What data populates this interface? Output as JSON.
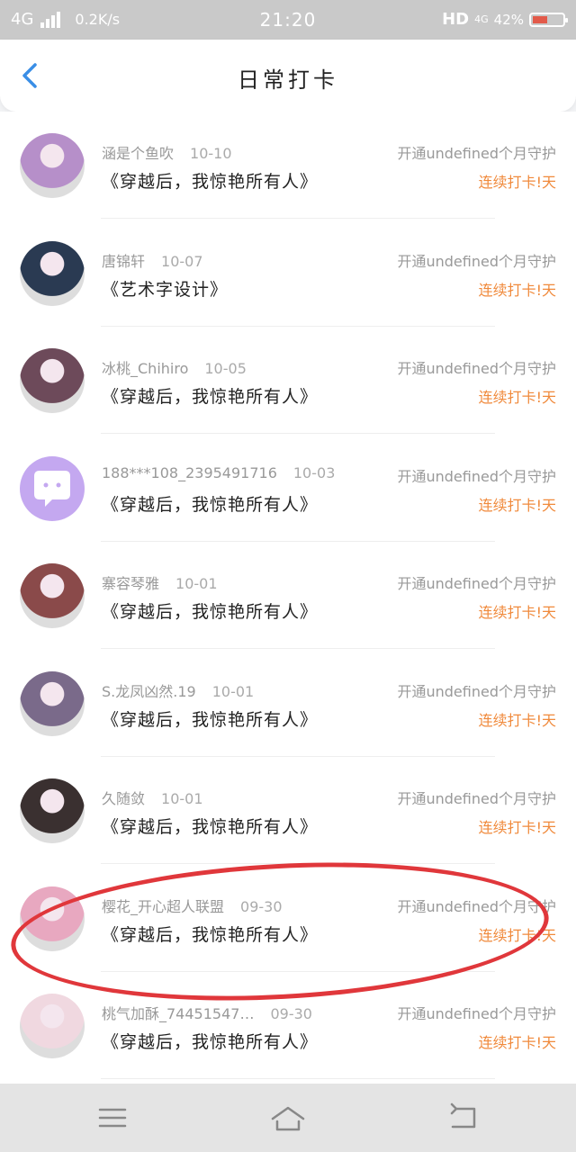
{
  "status_bar": {
    "network": "4G",
    "speed": "0.2K/s",
    "time": "21:20",
    "hd": "HD",
    "hd_network": "4G",
    "battery": "42%",
    "battery_level": 0.42
  },
  "header": {
    "title": "日常打卡",
    "back_icon": "chevron-left-icon"
  },
  "checkins": [
    {
      "user": "涵是个鱼吹",
      "date": "10-10",
      "book": "《穿越后，我惊艳所有人》",
      "guard": "开通undefined个月守护",
      "streak": "连续打卡!天"
    },
    {
      "user": "唐锦轩",
      "date": "10-07",
      "book": "《艺术字设计》",
      "guard": "开通undefined个月守护",
      "streak": "连续打卡!天"
    },
    {
      "user": "冰桃_Chihiro",
      "date": "10-05",
      "book": "《穿越后，我惊艳所有人》",
      "guard": "开通undefined个月守护",
      "streak": "连续打卡!天"
    },
    {
      "user": "188***108_2395491716",
      "date": "10-03",
      "book": "《穿越后，我惊艳所有人》",
      "guard": "开通undefined个月守护",
      "streak": "连续打卡!天"
    },
    {
      "user": "寨容琴雅",
      "date": "10-01",
      "book": "《穿越后，我惊艳所有人》",
      "guard": "开通undefined个月守护",
      "streak": "连续打卡!天"
    },
    {
      "user": "S.龙凤凶然.19",
      "date": "10-01",
      "book": "《穿越后，我惊艳所有人》",
      "guard": "开通undefined个月守护",
      "streak": "连续打卡!天"
    },
    {
      "user": "久随敛",
      "date": "10-01",
      "book": "《穿越后，我惊艳所有人》",
      "guard": "开通undefined个月守护",
      "streak": "连续打卡!天"
    },
    {
      "user": "樱花_开心超人联盟",
      "date": "09-30",
      "book": "《穿越后，我惊艳所有人》",
      "guard": "开通undefined个月守护",
      "streak": "连续打卡!天"
    },
    {
      "user": "桃气加酥_74451547…",
      "date": "09-30",
      "book": "《穿越后，我惊艳所有人》",
      "guard": "开通undefined个月守护",
      "streak": "连续打卡!天"
    }
  ],
  "avatar_colors": [
    "#b68fc9",
    "#2a3a52",
    "#6d4a5a",
    "#c4a8f0",
    "#8a4a4a",
    "#7a6a8a",
    "#3a3030",
    "#e8a8c0",
    "#f0d8e0"
  ],
  "colors": {
    "accent_orange": "#f08a3c",
    "annotation_red": "#e0373b",
    "back_blue": "#3a8ee6"
  },
  "nav_bar": {
    "menu_icon": "menu-icon",
    "home_icon": "home-icon",
    "back_icon": "back-return-icon"
  }
}
